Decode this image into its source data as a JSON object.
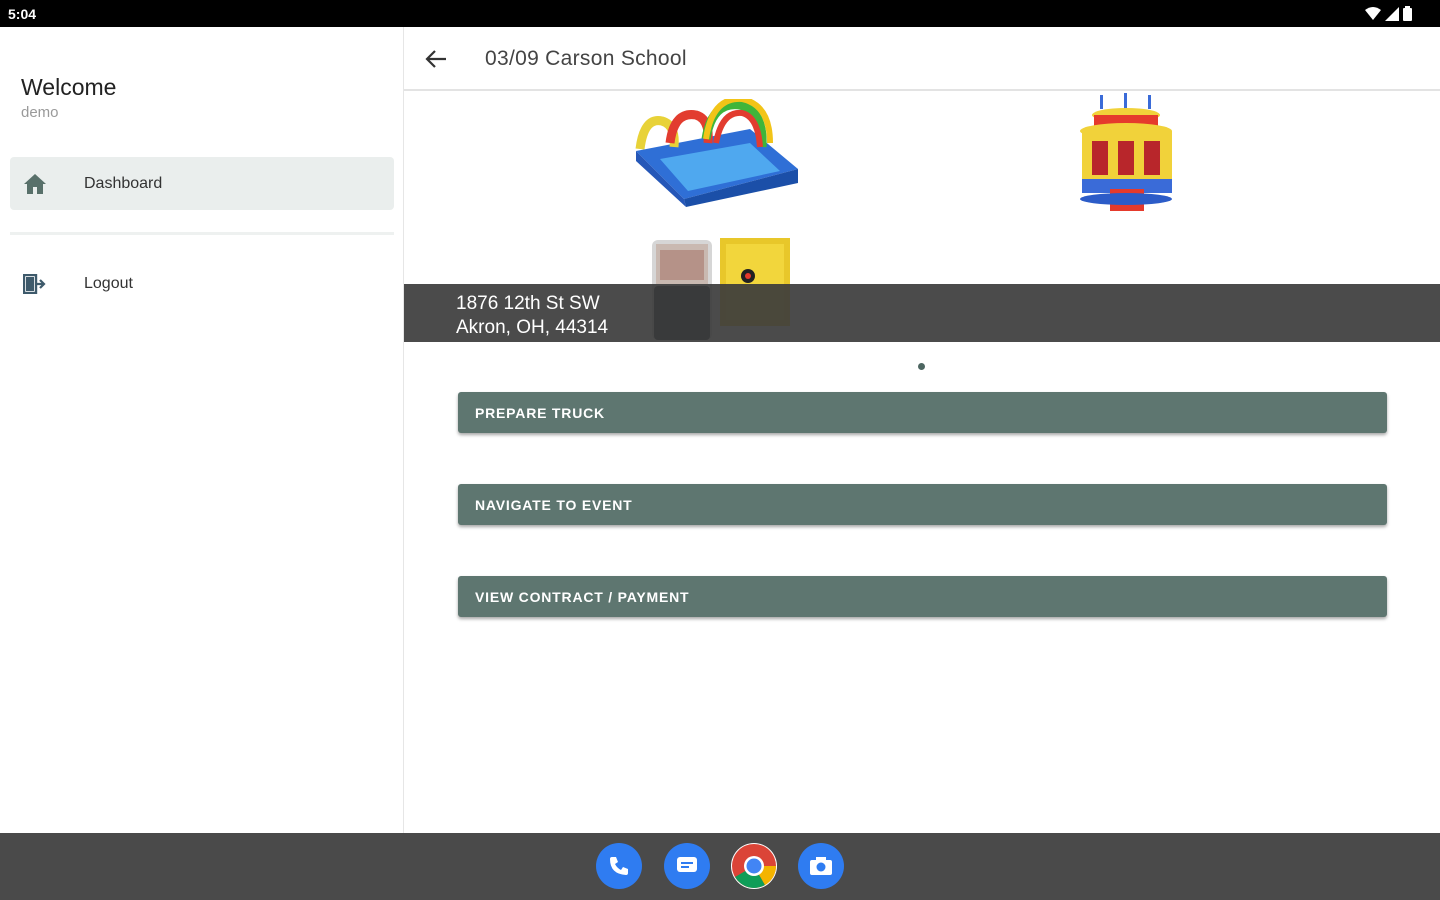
{
  "status_bar": {
    "time": "5:04"
  },
  "drawer": {
    "welcome": "Welcome",
    "username": "demo",
    "items": [
      {
        "label": "Dashboard",
        "icon": "home-icon"
      },
      {
        "label": "Logout",
        "icon": "logout-icon"
      }
    ]
  },
  "appbar": {
    "title": "03/09 Carson School"
  },
  "event": {
    "address_line1": "1876 12th St SW",
    "address_line2": "Akron, OH, 44314",
    "carousel_page": 1,
    "carousel_total": 1
  },
  "actions": {
    "prepare_truck": "PREPARE TRUCK",
    "navigate": "NAVIGATE TO EVENT",
    "contract": "VIEW CONTRACT / PAYMENT"
  },
  "dock": [
    "phone-icon",
    "messages-icon",
    "chrome-icon",
    "camera-icon"
  ],
  "colors": {
    "accent": "#5e7670",
    "overlay": "#3c3c3c",
    "navbar": "#4a4a4a",
    "active_item": "#eaeeed"
  }
}
